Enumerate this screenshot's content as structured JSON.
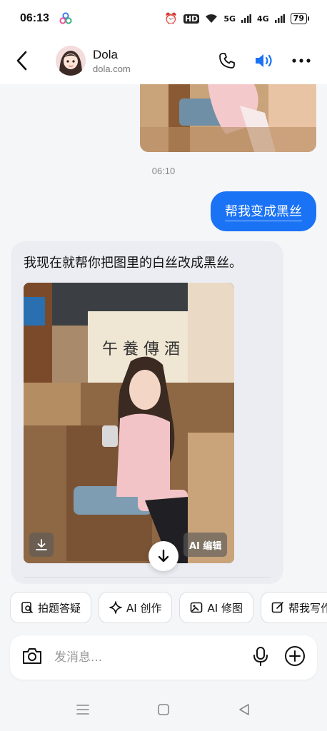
{
  "status_bar": {
    "time": "06:13",
    "hd_label": "HD",
    "net_1": "5G",
    "net_2": "4G",
    "battery": "79"
  },
  "header": {
    "contact_name": "Dola",
    "contact_subtitle": "dola.com",
    "icons": [
      "back-arrow-icon",
      "phone-icon",
      "speaker-icon",
      "more-icon"
    ],
    "accent_color": "#1a72f5"
  },
  "chat": {
    "timestamp": "06:10",
    "user_message": "帮我变成黑丝",
    "bot_message": "我现在就帮你把图里的白丝改成黑丝。",
    "image_edit_label": "AI 编辑"
  },
  "quick_actions": [
    {
      "label": "拍题答疑",
      "icon": "photo-question-icon"
    },
    {
      "label": "AI 创作",
      "icon": "sparkle-icon"
    },
    {
      "label": "AI 修图",
      "icon": "image-edit-icon"
    },
    {
      "label": "帮我写作",
      "icon": "write-icon"
    }
  ],
  "input": {
    "placeholder": "发消息..."
  }
}
